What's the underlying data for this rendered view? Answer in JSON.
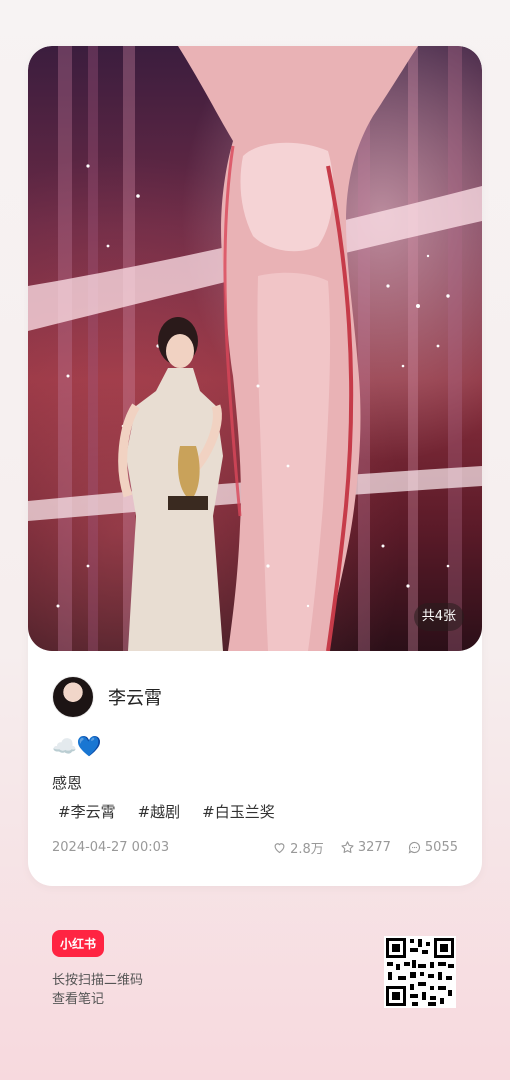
{
  "post": {
    "image_count_label": "共4张",
    "author_name": "李云霄",
    "emoji_text": "☁️💙",
    "description": "感恩",
    "tags": [
      "#李云霄",
      "#越剧",
      "#白玉兰奖"
    ],
    "date": "2024-04-27 00:03",
    "likes": "2.8万",
    "favorites": "3277",
    "comments": "5055"
  },
  "footer": {
    "logo_text": "小红书",
    "hint_line1": "长按扫描二维码",
    "hint_line2": "查看笔记"
  },
  "colors": {
    "brand": "#ff2442",
    "heart_blue": "#2e7be6"
  },
  "icons": {
    "likes": "heart-outline-icon",
    "favorites": "star-outline-icon",
    "comments": "comment-bubble-icon"
  }
}
